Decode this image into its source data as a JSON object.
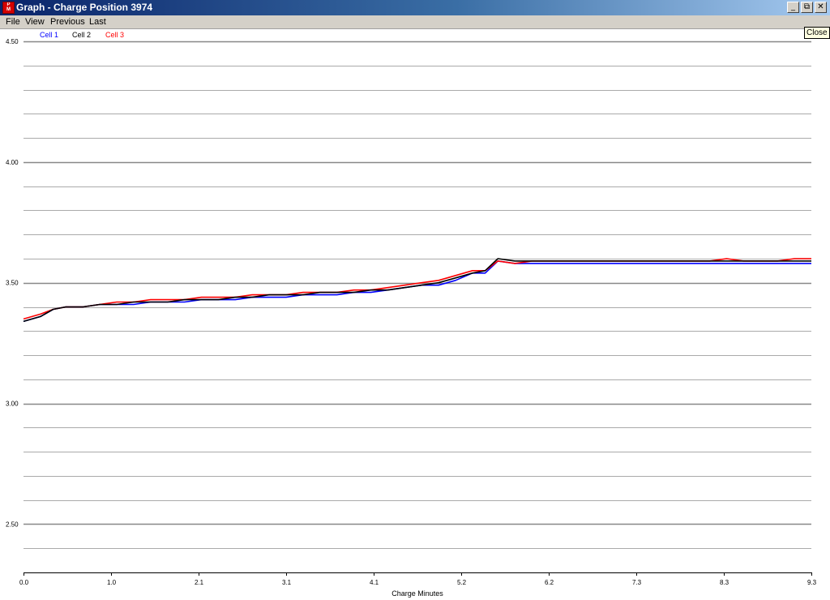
{
  "window": {
    "title": "Graph - Charge Position 3974",
    "icon": "app-logo-icon",
    "icon_text": [
      "P",
      "M"
    ],
    "buttons": [
      "_",
      "⧉",
      "✕"
    ]
  },
  "menu": [
    "File",
    "View",
    "Previous",
    "Last"
  ],
  "tooltip": "Close",
  "colors": {
    "cell1": "#0000ff",
    "cell2": "#000000",
    "cell3": "#ff0000",
    "grid": "#aaaaaa"
  },
  "chart_data": {
    "type": "line",
    "xlabel": "Charge Minutes",
    "ylabel": "",
    "xlim": [
      0.0,
      9.3
    ],
    "ylim": [
      2.3,
      4.5
    ],
    "x_ticks": [
      "0.0",
      "1.0",
      "2.1",
      "3.1",
      "4.1",
      "5.2",
      "6.2",
      "7.3",
      "8.3",
      "9.3"
    ],
    "y_ticks": [
      "4.50",
      "4.00",
      "3.50",
      "3.00",
      "2.50"
    ],
    "grid": true,
    "legend_position": "top-left",
    "x": [
      0.0,
      0.2,
      0.35,
      0.5,
      0.7,
      0.9,
      1.1,
      1.3,
      1.5,
      1.7,
      1.9,
      2.1,
      2.3,
      2.5,
      2.7,
      2.9,
      3.1,
      3.3,
      3.5,
      3.7,
      3.9,
      4.1,
      4.3,
      4.5,
      4.7,
      4.9,
      5.1,
      5.3,
      5.45,
      5.6,
      5.8,
      6.0,
      6.2,
      6.4,
      6.6,
      6.8,
      7.0,
      7.3,
      7.6,
      7.9,
      8.1,
      8.3,
      8.5,
      8.7,
      8.9,
      9.1,
      9.3
    ],
    "series": [
      {
        "name": "Cell 1",
        "color": "#0000ff",
        "values": [
          3.34,
          3.36,
          3.39,
          3.4,
          3.4,
          3.41,
          3.41,
          3.41,
          3.42,
          3.42,
          3.42,
          3.43,
          3.43,
          3.43,
          3.44,
          3.44,
          3.44,
          3.45,
          3.45,
          3.45,
          3.46,
          3.46,
          3.47,
          3.48,
          3.49,
          3.49,
          3.51,
          3.54,
          3.54,
          3.59,
          3.58,
          3.58,
          3.58,
          3.58,
          3.58,
          3.58,
          3.58,
          3.58,
          3.58,
          3.58,
          3.58,
          3.58,
          3.58,
          3.58,
          3.58,
          3.58,
          3.58
        ]
      },
      {
        "name": "Cell 2",
        "color": "#000000",
        "values": [
          3.34,
          3.36,
          3.39,
          3.4,
          3.4,
          3.41,
          3.41,
          3.42,
          3.42,
          3.42,
          3.43,
          3.43,
          3.43,
          3.44,
          3.44,
          3.45,
          3.45,
          3.45,
          3.46,
          3.46,
          3.46,
          3.47,
          3.47,
          3.48,
          3.49,
          3.5,
          3.52,
          3.54,
          3.55,
          3.6,
          3.59,
          3.59,
          3.59,
          3.59,
          3.59,
          3.59,
          3.59,
          3.59,
          3.59,
          3.59,
          3.59,
          3.59,
          3.59,
          3.59,
          3.59,
          3.59,
          3.59
        ]
      },
      {
        "name": "Cell 3",
        "color": "#ff0000",
        "values": [
          3.35,
          3.37,
          3.39,
          3.4,
          3.4,
          3.41,
          3.42,
          3.42,
          3.43,
          3.43,
          3.43,
          3.44,
          3.44,
          3.44,
          3.45,
          3.45,
          3.45,
          3.46,
          3.46,
          3.46,
          3.47,
          3.47,
          3.48,
          3.49,
          3.5,
          3.51,
          3.53,
          3.55,
          3.55,
          3.59,
          3.58,
          3.59,
          3.59,
          3.59,
          3.59,
          3.59,
          3.59,
          3.59,
          3.59,
          3.59,
          3.59,
          3.6,
          3.59,
          3.59,
          3.59,
          3.6,
          3.6
        ]
      }
    ]
  }
}
